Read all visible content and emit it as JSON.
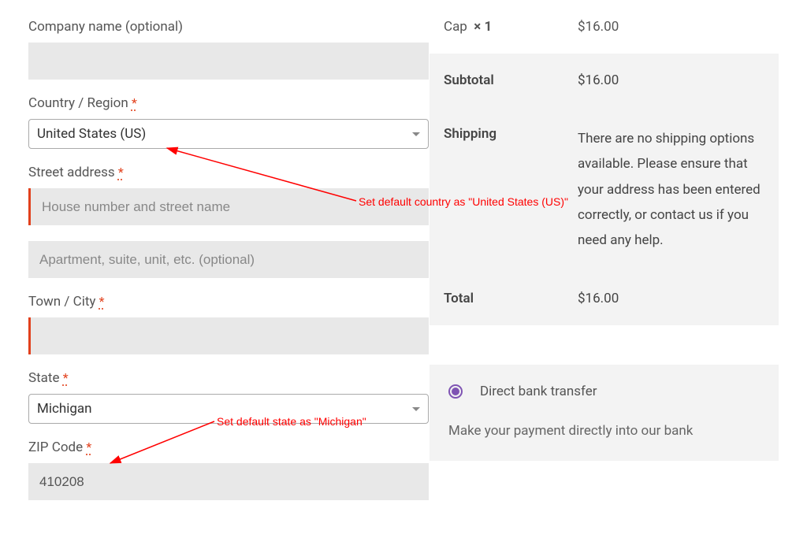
{
  "form": {
    "company_label": "Company name (optional)",
    "company_value": "",
    "country_label": "Country / Region",
    "country_value": "United States (US)",
    "street_label": "Street address",
    "street1_placeholder": "House number and street name",
    "street2_placeholder": "Apartment, suite, unit, etc. (optional)",
    "city_label": "Town / City",
    "city_value": "",
    "state_label": "State",
    "state_value": "Michigan",
    "zip_label": "ZIP Code",
    "zip_value": "410208"
  },
  "summary": {
    "item_name": "Cap",
    "item_qty": "× 1",
    "item_price": "$16.00",
    "subtotal_label": "Subtotal",
    "subtotal_value": "$16.00",
    "shipping_label": "Shipping",
    "shipping_value": "There are no shipping options available. Please ensure that your address has been entered correctly, or contact us if you need any help.",
    "total_label": "Total",
    "total_value": "$16.00"
  },
  "payment": {
    "method": "Direct bank transfer",
    "desc": "Make your payment directly into our bank"
  },
  "annotations": {
    "a1": "Set default country as \"United States (US)\"",
    "a2": "Set default state as \"Michigan\""
  }
}
